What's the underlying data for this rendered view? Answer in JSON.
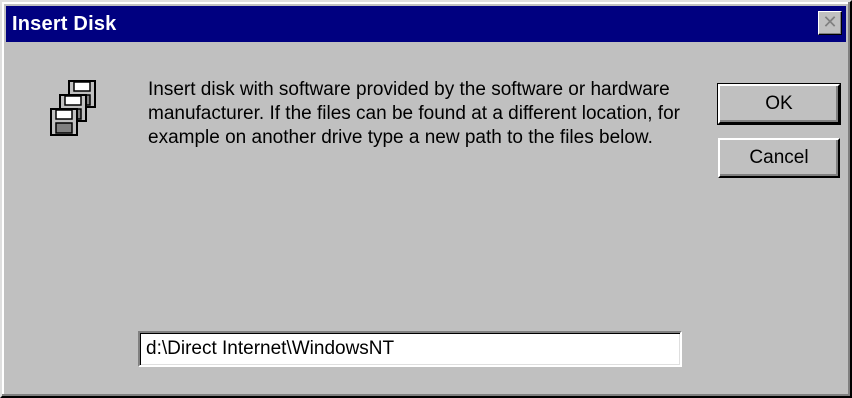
{
  "window": {
    "title": "Insert Disk",
    "close_symbol": "✕"
  },
  "icon": {
    "name": "floppy-disks-icon"
  },
  "message": {
    "text": "Insert disk with software provided by the software or hardware manufacturer.  If the files can be found at a different location, for example on another drive type a new path to the files below."
  },
  "buttons": {
    "ok_label": "OK",
    "cancel_label": "Cancel"
  },
  "path_field": {
    "value": "d:\\Direct Internet\\WindowsNT"
  },
  "colors": {
    "titlebar": "#000080",
    "face": "#c0c0c0",
    "title_text": "#ffffff"
  }
}
